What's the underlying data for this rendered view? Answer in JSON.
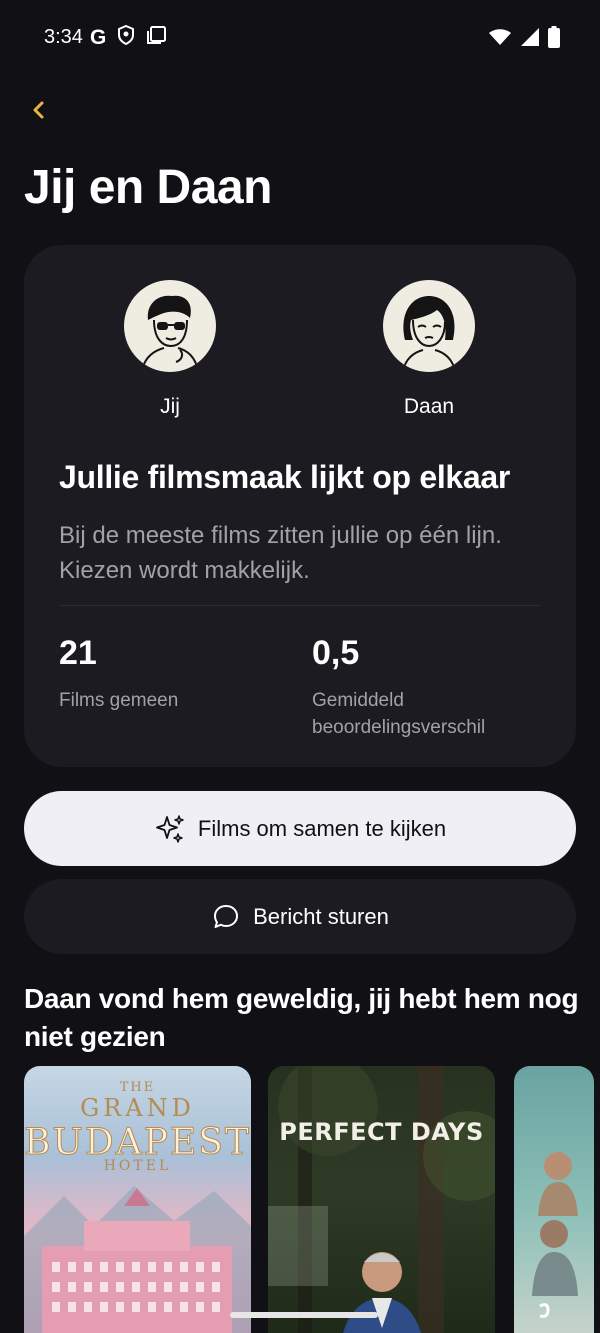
{
  "status_bar": {
    "time": "3:34",
    "g_label": "G"
  },
  "header": {
    "title": "Jij en Daan"
  },
  "card": {
    "user_left": {
      "name": "Jij"
    },
    "user_right": {
      "name": "Daan"
    },
    "match_title": "Jullie filmsmaak lijkt op elkaar",
    "match_description": "Bij de meeste films zitten jullie op één lijn. Kiezen wordt makkelijk.",
    "stats": [
      {
        "value": "21",
        "label": "Films gemeen"
      },
      {
        "value": "0,5",
        "label": "Gemiddeld beoordelingsverschil"
      }
    ]
  },
  "buttons": {
    "watch_together": "Films om samen te kijken",
    "send_message": "Bericht sturen"
  },
  "section": {
    "title": "Daan vond hem geweldig, jij hebt hem nog niet gezien",
    "posters": [
      {
        "the": "THE",
        "grand": "GRAND",
        "main": "BUDAPEST",
        "hotel": "HOTEL"
      },
      {
        "main": "PERFECT DAYS"
      },
      {
        "main": ""
      }
    ]
  },
  "colors": {
    "accent": "#e9b53a",
    "background": "#111115",
    "card": "#1b1b21",
    "primary_button": "#f0eff5"
  },
  "icons": [
    "google-g-icon",
    "shield-icon",
    "screen-icon",
    "wifi-icon",
    "signal-icon",
    "battery-icon",
    "back-chevron-icon",
    "sparkles-icon",
    "chat-bubble-icon"
  ]
}
